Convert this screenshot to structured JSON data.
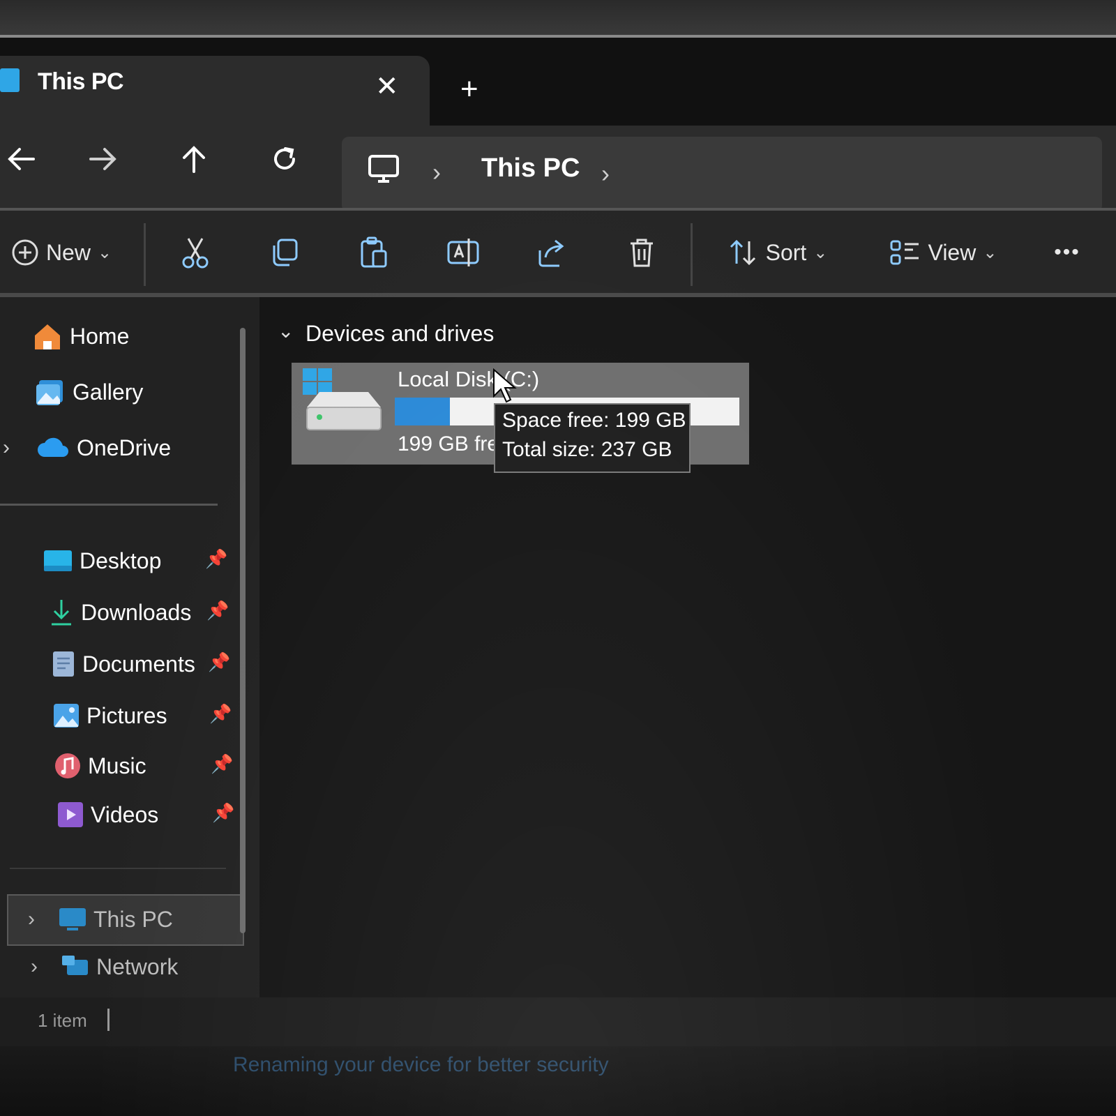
{
  "window": {
    "tab_title": "This PC",
    "close_glyph": "✕",
    "new_tab_glyph": "+"
  },
  "nav": {
    "back_icon": "arrow-left-icon",
    "forward_icon": "arrow-right-icon",
    "up_icon": "arrow-up-icon",
    "refresh_icon": "refresh-icon",
    "breadcrumb": [
      "This PC"
    ],
    "separator": "›"
  },
  "toolbar": {
    "new_label": "New",
    "sort_label": "Sort",
    "view_label": "View",
    "more_glyph": "•••",
    "chevron": "⌄",
    "icons": [
      "cut-icon",
      "copy-icon",
      "paste-icon",
      "rename-icon",
      "share-icon",
      "delete-icon"
    ]
  },
  "sidebar": {
    "top_items": [
      {
        "label": "Home",
        "icon": "home-icon"
      },
      {
        "label": "Gallery",
        "icon": "gallery-icon"
      },
      {
        "label": "OneDrive",
        "icon": "cloud-icon"
      }
    ],
    "pinned": [
      {
        "label": "Desktop",
        "icon": "desktop-folder-icon"
      },
      {
        "label": "Downloads",
        "icon": "download-icon"
      },
      {
        "label": "Documents",
        "icon": "documents-icon"
      },
      {
        "label": "Pictures",
        "icon": "pictures-icon"
      },
      {
        "label": "Music",
        "icon": "music-icon"
      },
      {
        "label": "Videos",
        "icon": "videos-icon"
      }
    ],
    "bottom_items": [
      {
        "label": "This PC",
        "icon": "computer-icon"
      },
      {
        "label": "Network",
        "icon": "network-icon"
      }
    ]
  },
  "content": {
    "section_title": "Devices and drives",
    "drive": {
      "name": "Local Disk (C:)",
      "free_text": "199 GB free of 237 GB",
      "used_fraction": 0.16
    },
    "tooltip": {
      "line1": "Space free: 199 GB",
      "line2": "Total size: 237 GB"
    }
  },
  "status": {
    "item_count": "1 item"
  },
  "notice": "Renaming your device for better security",
  "colors": {
    "accent": "#2b8ad8",
    "background": "#1b1b1b"
  }
}
